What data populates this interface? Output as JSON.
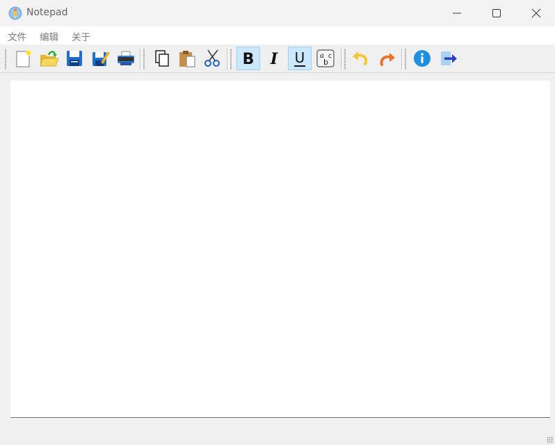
{
  "window": {
    "title": "Notepad",
    "controls": {
      "minimize": "minimize-icon",
      "maximize": "maximize-icon",
      "close": "close-icon"
    }
  },
  "menu": {
    "items": [
      {
        "label": "文件"
      },
      {
        "label": "编辑"
      },
      {
        "label": "关于"
      }
    ]
  },
  "toolbar": {
    "buttons": [
      {
        "icon": "new-file-icon",
        "checked": false
      },
      {
        "icon": "open-folder-icon",
        "checked": false
      },
      {
        "icon": "save-icon",
        "checked": false
      },
      {
        "icon": "save-as-icon",
        "checked": false
      },
      {
        "icon": "print-icon",
        "checked": false
      },
      {
        "icon": "copy-icon",
        "checked": false
      },
      {
        "icon": "paste-icon",
        "checked": false
      },
      {
        "icon": "cut-icon",
        "checked": false
      },
      {
        "icon": "bold-icon",
        "checked": true
      },
      {
        "icon": "italic-icon",
        "checked": false
      },
      {
        "icon": "underline-icon",
        "checked": true
      },
      {
        "icon": "font-icon",
        "checked": false
      },
      {
        "icon": "undo-icon",
        "checked": false
      },
      {
        "icon": "redo-icon",
        "checked": false
      },
      {
        "icon": "info-icon",
        "checked": false
      },
      {
        "icon": "exit-icon",
        "checked": false
      }
    ],
    "colors": {
      "checked_bg": "#cce8ff",
      "checked_border": "#99d1ff"
    }
  },
  "editor": {
    "content": ""
  }
}
